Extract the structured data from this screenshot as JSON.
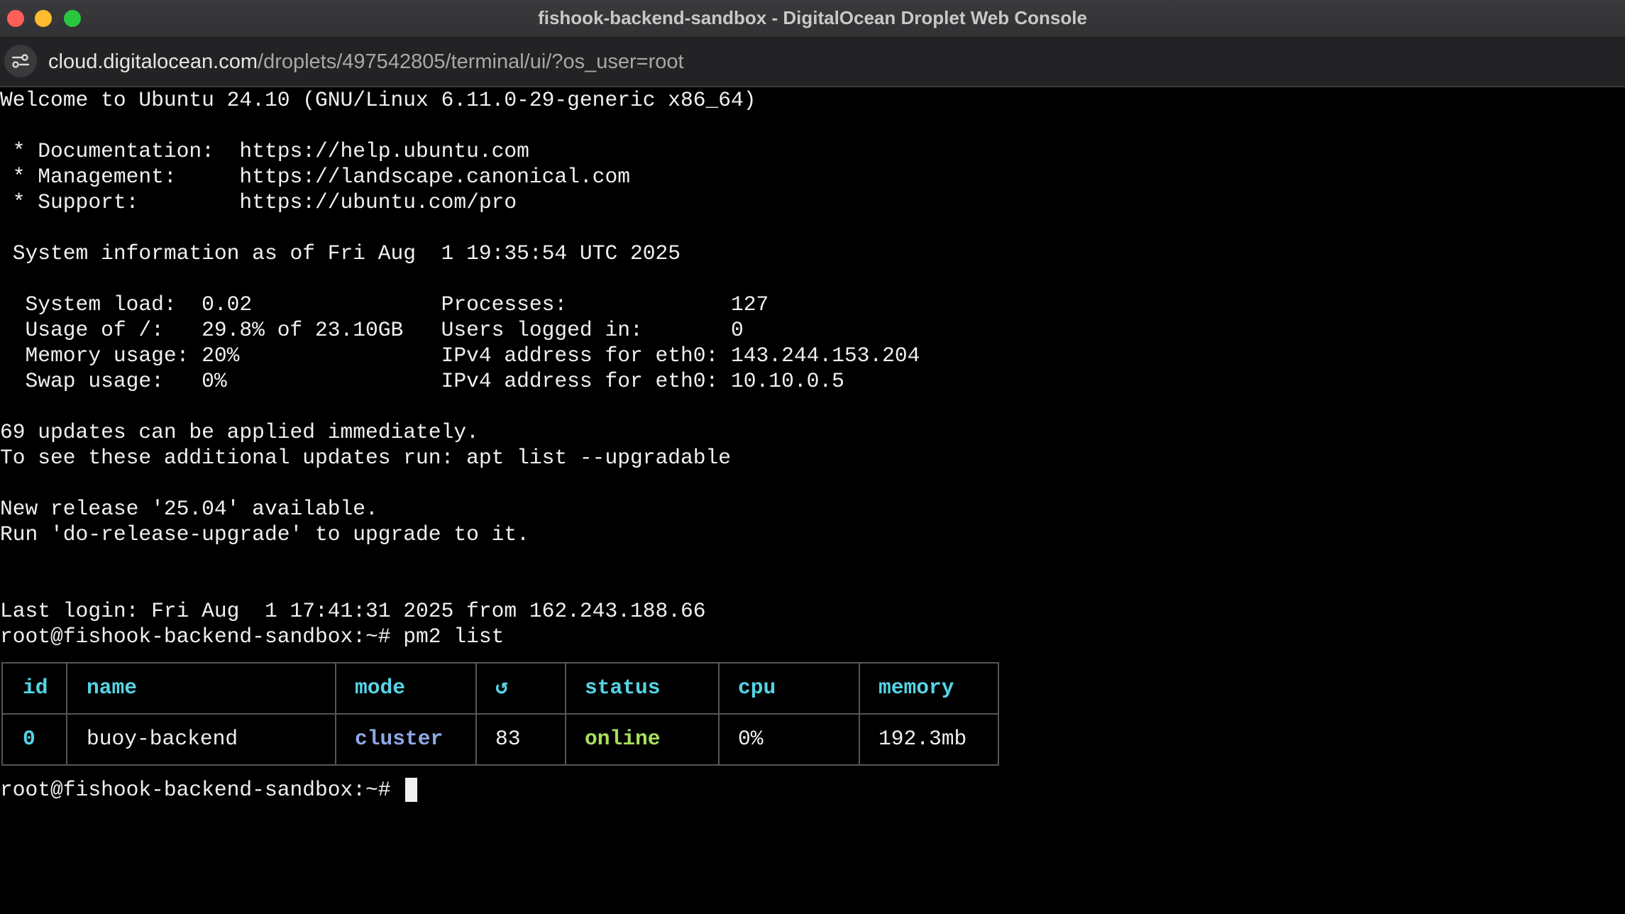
{
  "window": {
    "title": "fishook-backend-sandbox - DigitalOcean Droplet Web Console",
    "controls": [
      "close",
      "minimize",
      "maximize"
    ]
  },
  "address_bar": {
    "icon": "site-settings-icon",
    "url_domain": "cloud.digitalocean.com",
    "url_path": "/droplets/497542805/terminal/ui/?os_user=root"
  },
  "terminal": {
    "lines": [
      "Welcome to Ubuntu 24.10 (GNU/Linux 6.11.0-29-generic x86_64)",
      "",
      " * Documentation:  https://help.ubuntu.com",
      " * Management:     https://landscape.canonical.com",
      " * Support:        https://ubuntu.com/pro",
      "",
      " System information as of Fri Aug  1 19:35:54 UTC 2025",
      "",
      "  System load:  0.02               Processes:             127",
      "  Usage of /:   29.8% of 23.10GB   Users logged in:       0",
      "  Memory usage: 20%                IPv4 address for eth0: 143.244.153.204",
      "  Swap usage:   0%                 IPv4 address for eth0: 10.10.0.5",
      "",
      "69 updates can be applied immediately.",
      "To see these additional updates run: apt list --upgradable",
      "",
      "New release '25.04' available.",
      "Run 'do-release-upgrade' to upgrade to it.",
      "",
      "",
      "Last login: Fri Aug  1 17:41:31 2025 from 162.243.188.66",
      "root@fishook-backend-sandbox:~# pm2 list"
    ],
    "pm2_table": {
      "headers": [
        "id",
        "name",
        "mode",
        "↺",
        "status",
        "cpu",
        "memory"
      ],
      "rows": [
        [
          "0",
          "buoy-backend",
          "cluster",
          "83",
          "online",
          "0%",
          "192.3mb"
        ]
      ]
    },
    "prompt": "root@fishook-backend-sandbox:~# "
  },
  "colors": {
    "header": "#56d4e6",
    "mode": "#8fa8e8",
    "status_online": "#a8e05c",
    "text": "#f0f0f0",
    "background": "#000000"
  }
}
